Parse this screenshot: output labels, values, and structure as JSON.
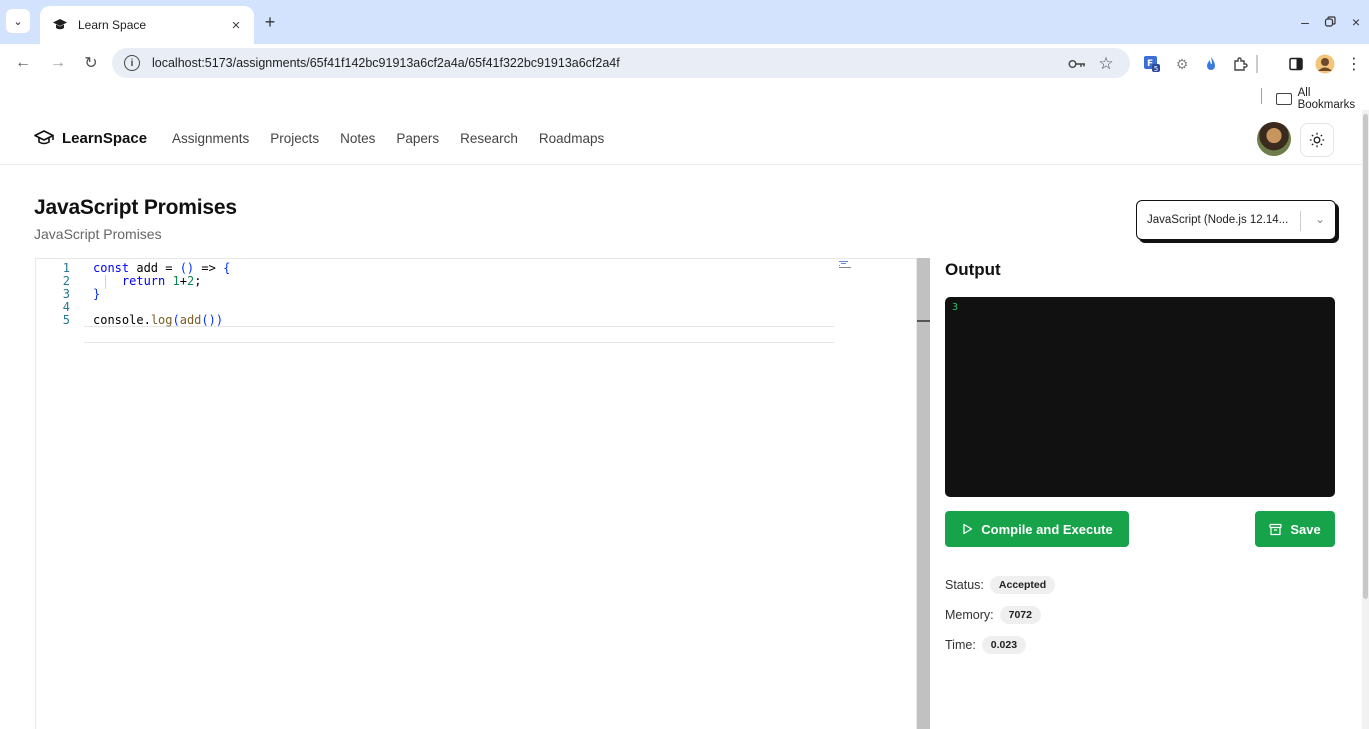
{
  "browser": {
    "tab_title": "Learn Space",
    "url": "localhost:5173/assignments/65f41f142bc91913a6cf2a4a/65f41f322bc91913a6cf2a4f",
    "bookmarks_label": "All Bookmarks"
  },
  "nav": {
    "brand": "LearnSpace",
    "links": [
      "Assignments",
      "Projects",
      "Notes",
      "Papers",
      "Research",
      "Roadmaps"
    ]
  },
  "assignment": {
    "title": "JavaScript Promises",
    "subtitle": "JavaScript Promises"
  },
  "language_select": {
    "selected": "JavaScript (Node.js 12.14..."
  },
  "editor": {
    "line_numbers": [
      "1",
      "2",
      "3",
      "4",
      "5"
    ],
    "lines": [
      [
        {
          "t": "const",
          "c": "kw"
        },
        {
          "t": " add = ",
          "c": ""
        },
        {
          "t": "()",
          "c": "brk"
        },
        {
          "t": " => ",
          "c": ""
        },
        {
          "t": "{",
          "c": "brk"
        }
      ],
      [
        {
          "t": "    return ",
          "c": "kw"
        },
        {
          "t": "1",
          "c": "num"
        },
        {
          "t": "+",
          "c": ""
        },
        {
          "t": "2",
          "c": "num"
        },
        {
          "t": ";",
          "c": ""
        }
      ],
      [
        {
          "t": "}",
          "c": "brk"
        }
      ],
      [],
      [
        {
          "t": "console",
          "c": ""
        },
        {
          "t": ".",
          "c": ""
        },
        {
          "t": "log",
          "c": "fnm"
        },
        {
          "t": "(",
          "c": "brk"
        },
        {
          "t": "add",
          "c": "fnm"
        },
        {
          "t": "()",
          "c": "brk"
        },
        {
          "t": ")",
          "c": "brk"
        }
      ]
    ]
  },
  "output": {
    "heading": "Output",
    "console_text": "3",
    "compile_label": "Compile and Execute",
    "save_label": "Save",
    "status_label": "Status:",
    "status_value": "Accepted",
    "memory_label": "Memory:",
    "memory_value": "7072",
    "time_label": "Time:",
    "time_value": "0.023"
  },
  "colors": {
    "accent_green": "#16a34a",
    "console_bg": "#111111",
    "tabstrip": "#d3e3fd"
  }
}
